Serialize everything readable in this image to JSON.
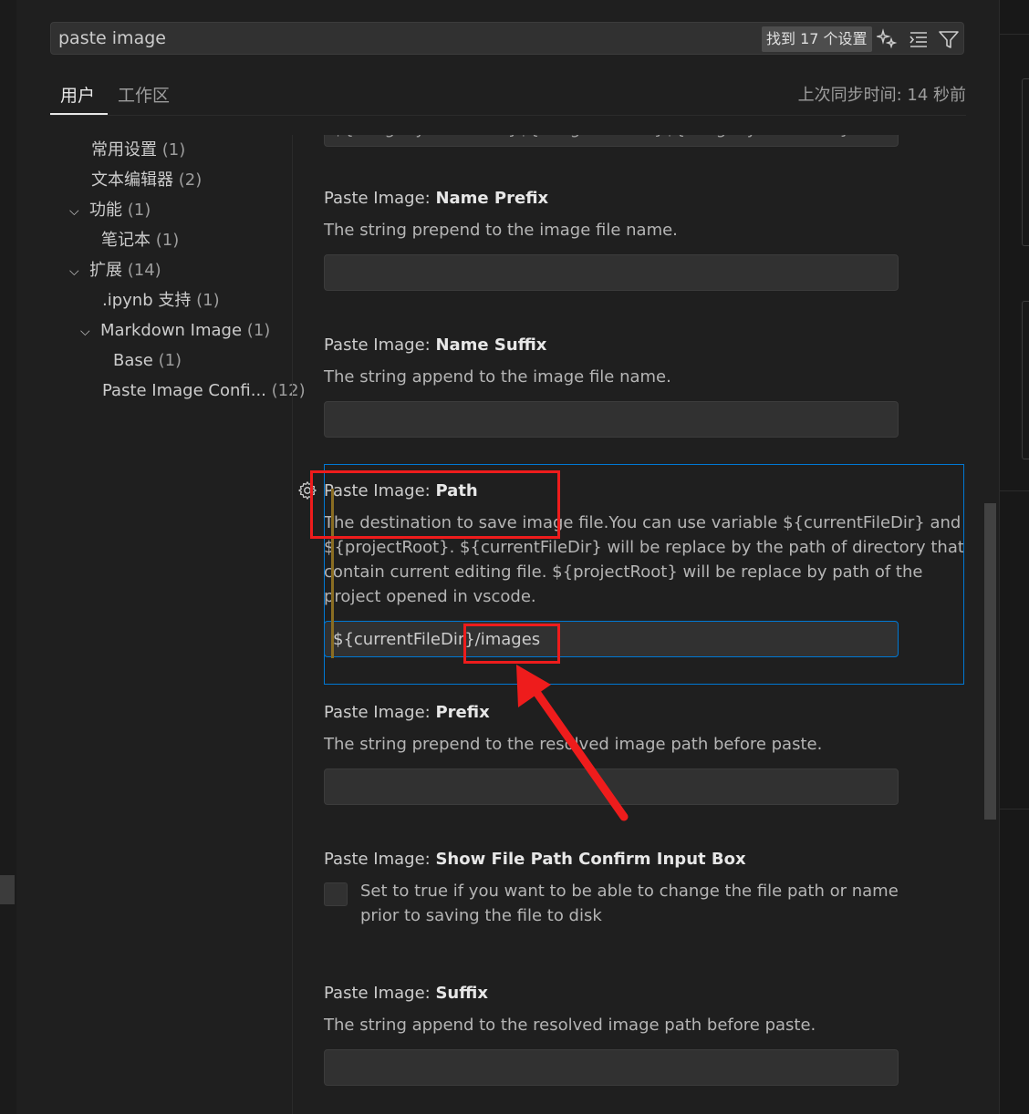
{
  "search": {
    "query": "paste image",
    "result_badge": "找到 17 个设置",
    "icons": [
      "sparkle-icon",
      "clear-filter-icon",
      "filter-icon"
    ]
  },
  "tabs": [
    {
      "label": "用户",
      "active": true
    },
    {
      "label": "工作区",
      "active": false
    }
  ],
  "sync_status": "上次同步时间: 14 秒前",
  "tree": [
    {
      "label": "常用设置",
      "count": "(1)",
      "expanded": null
    },
    {
      "label": "文本编辑器",
      "count": "(2)",
      "expanded": null
    },
    {
      "label": "功能",
      "count": "(1)",
      "expanded": true
    },
    {
      "label": "笔记本",
      "count": "(1)",
      "expanded": null
    },
    {
      "label": "扩展",
      "count": "(14)",
      "expanded": true
    },
    {
      "label": ".ipynb 支持",
      "count": "(1)",
      "expanded": null
    },
    {
      "label": "Markdown Image",
      "count": "(1)",
      "expanded": true
    },
    {
      "label": "Base",
      "count": "(1)",
      "expanded": null
    },
    {
      "label": "Paste Image Confi...",
      "count": "(12)",
      "expanded": null
    }
  ],
  "settings": {
    "partial_value": "${imageSyntaxPrefix}${imageFilePath}${imageSyntaxSuffix}",
    "name_prefix": {
      "category": "Paste Image: ",
      "name": "Name Prefix",
      "description": "The string prepend to the image file name.",
      "value": ""
    },
    "name_suffix": {
      "category": "Paste Image: ",
      "name": "Name Suffix",
      "description": "The string append to the image file name.",
      "value": ""
    },
    "path": {
      "category": "Paste Image: ",
      "name": "Path",
      "description": "The destination to save image file.You can use variable ${currentFileDir} and ${projectRoot}. ${currentFileDir} will be replace by the path of directory that contain current editing file. ${projectRoot} will be replace by path of the project opened in vscode.",
      "value": "${currentFileDir}/images",
      "modified": true
    },
    "prefix": {
      "category": "Paste Image: ",
      "name": "Prefix",
      "description": "The string prepend to the resolved image path before paste.",
      "value": ""
    },
    "show_confirm": {
      "category": "Paste Image: ",
      "name": "Show File Path Confirm Input Box",
      "description": "Set to true if you want to be able to change the file path or name prior to saving the file to disk",
      "checked": false
    },
    "suffix": {
      "category": "Paste Image: ",
      "name": "Suffix",
      "description": "The string append to the resolved image path before paste.",
      "value": ""
    }
  },
  "colors": {
    "accent": "#0078d4",
    "annotation": "#ee1c1c",
    "modified_indicator": "#8a6d22"
  }
}
